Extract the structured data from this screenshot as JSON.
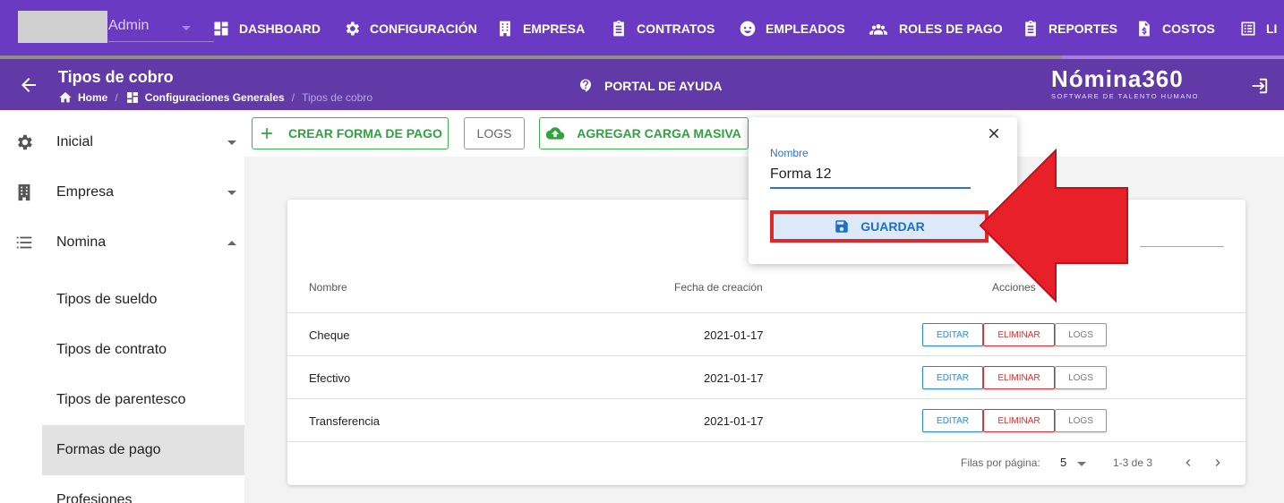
{
  "user": {
    "name": "Admin"
  },
  "nav": {
    "items": [
      {
        "label": "DASHBOARD",
        "icon": "dashboard-icon"
      },
      {
        "label": "CONFIGURACIÓN",
        "icon": "gear-icon"
      },
      {
        "label": "EMPRESA",
        "icon": "building-icon"
      },
      {
        "label": "CONTRATOS",
        "icon": "clipboard-icon"
      },
      {
        "label": "EMPLEADOS",
        "icon": "face-icon"
      },
      {
        "label": "ROLES DE PAGO",
        "icon": "people-icon"
      },
      {
        "label": "REPORTES",
        "icon": "clipboard-icon"
      },
      {
        "label": "COSTOS",
        "icon": "invoice-icon"
      },
      {
        "label": "LI",
        "icon": "list-icon"
      }
    ]
  },
  "header": {
    "title": "Tipos de cobro",
    "breadcrumb": {
      "home": "Home",
      "section": "Configuraciones Generales",
      "current": "Tipos de cobro",
      "separator": "/"
    },
    "help": "PORTAL DE AYUDA",
    "logo": "Nómina360",
    "logo_tagline": "SOFTWARE DE TALENTO HUMANO"
  },
  "sidebar": {
    "groups": [
      {
        "label": "Inicial",
        "icon": "gear-icon"
      },
      {
        "label": "Empresa",
        "icon": "building-icon"
      },
      {
        "label": "Nomina",
        "icon": "list-icon"
      }
    ],
    "subitems": [
      "Tipos de sueldo",
      "Tipos de contrato",
      "Tipos de parentesco",
      "Formas de pago",
      "Profesiones"
    ],
    "active_subitem": "Formas de pago"
  },
  "toolbar": {
    "create_label": "CREAR FORMA DE PAGO",
    "logs_label": "LOGS",
    "bulk_label": "AGREGAR CARGA MASIVA"
  },
  "table": {
    "headers": {
      "name": "Nombre",
      "date": "Fecha de creación",
      "actions": "Acciones"
    },
    "rows": [
      {
        "name": "Cheque",
        "date": "2021-01-17"
      },
      {
        "name": "Efectivo",
        "date": "2021-01-17"
      },
      {
        "name": "Transferencia",
        "date": "2021-01-17"
      }
    ],
    "action_labels": {
      "edit": "EDITAR",
      "delete": "ELIMINAR",
      "logs": "LOGS"
    },
    "pagination": {
      "rows_per_page_label": "Filas por página:",
      "rows_per_page": "5",
      "range": "1-3 de 3"
    }
  },
  "popover": {
    "field_label": "Nombre",
    "field_value": "Forma 12",
    "save_label": "GUARDAR"
  },
  "colors": {
    "nav": "#6a3bc2",
    "subheader": "#613aa8",
    "green": "#2ea33e",
    "blue": "#2e86de",
    "red": "#d32f2f",
    "annotation": "#e12828"
  }
}
